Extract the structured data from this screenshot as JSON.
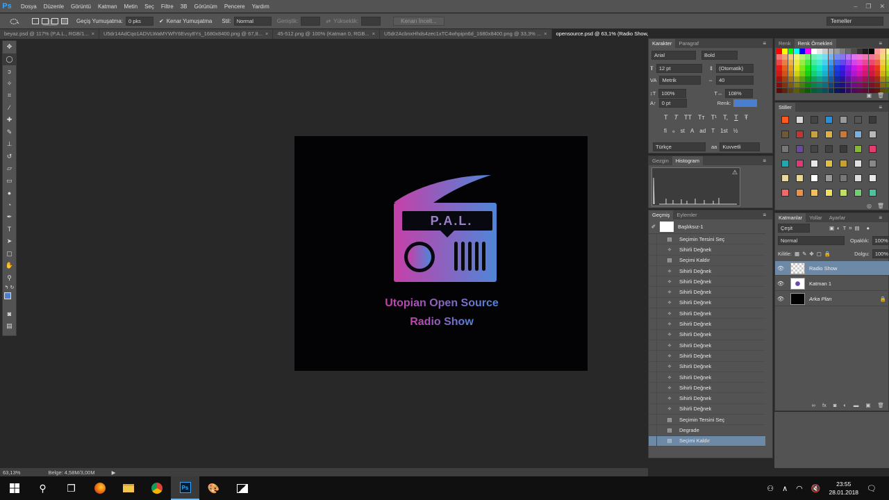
{
  "app_logo": "Ps",
  "menu": [
    "Dosya",
    "Düzenle",
    "Görüntü",
    "Katman",
    "Metin",
    "Seç",
    "Filtre",
    "3B",
    "Görünüm",
    "Pencere",
    "Yardım"
  ],
  "window_controls": [
    "–",
    "❐",
    "✕"
  ],
  "options": {
    "feather_label": "Geçiş Yumuşatma:",
    "feather_value": "0 pks",
    "anti_alias": "Kenar Yumuşatma",
    "style_label": "Stil:",
    "style_value": "Normal",
    "width_label": "Genişlik:",
    "height_label": "Yükseklik:",
    "refine_button": "Kenarı İncelt...",
    "workspace": "Temeller"
  },
  "doc_tabs": [
    {
      "label": "beyaz.psd @ 117% (P.A.L., RGB/1...",
      "close": "×"
    },
    {
      "label": "U5dr14AdCqo1ADVLWaMYWfY6Evsy8Ys_1680x8400.png @ 67,8...",
      "close": "×"
    },
    {
      "label": "45-512.png @ 100% (Katman 0, RGB...",
      "close": "×"
    },
    {
      "label": "U5dr2AcbnxHhds4zec1xTC4whpipn6d_1680x8400.png @ 33,3% ...",
      "close": "×"
    },
    {
      "label": "opensource.psd @ 63,1% (Radio Show, RGB/8)",
      "close": "×"
    }
  ],
  "artwork": {
    "radio_label": "P.A.L.",
    "line1": "Utopian Open Source",
    "line2": "Radio Show",
    "grad_start": "#c540a8",
    "grad_end": "#4f86d8"
  },
  "status": {
    "zoom": "63,13%",
    "doc": "Belge: 4,58M/3,00M",
    "arrow": "▶"
  },
  "character": {
    "tabs": [
      "Karakter",
      "Paragraf"
    ],
    "font": "Arial",
    "style": "Bold",
    "size": "12 pt",
    "leading": "(Otomatik)",
    "kerning": "Metrik",
    "tracking": "40",
    "vscale": "100%",
    "hscale": "108%",
    "baseline": "0 pt",
    "color_label": "Renk:",
    "color": "#4a7fd0",
    "lang": "Türkçe",
    "aa": "Kuvvetli",
    "typo_buttons": [
      "T",
      "T",
      "TT",
      "Tт",
      "T¹",
      "T,",
      "T",
      "Ŧ"
    ],
    "ot_buttons": [
      "fi",
      "ℴ",
      "st",
      "A",
      "ad",
      "T",
      "1st",
      "½"
    ]
  },
  "color_panel": {
    "tabs": [
      "Renk",
      "Renk Örnekleri"
    ]
  },
  "styles_panel": {
    "title": "Stiller"
  },
  "navigator": {
    "tabs": [
      "Gezgin",
      "Histogram"
    ],
    "warn": "⚠"
  },
  "history": {
    "tabs": [
      "Geçmiş",
      "Eylemler"
    ],
    "snapshot": "Başlıksız-1",
    "items": [
      "Seçimin Tersini Seç",
      "Sihirli Değnek",
      "Seçimi Kaldır",
      "Sihirli Değnek",
      "Sihirli Değnek",
      "Sihirli Değnek",
      "Sihirli Değnek",
      "Sihirli Değnek",
      "Sihirli Değnek",
      "Sihirli Değnek",
      "Sihirli Değnek",
      "Sihirli Değnek",
      "Sihirli Değnek",
      "Sihirli Değnek",
      "Sihirli Değnek",
      "Sihirli Değnek",
      "Sihirli Değnek",
      "Seçimin Tersini Seç",
      "Degrade",
      "Seçimi Kaldır"
    ],
    "selected": 19
  },
  "layers": {
    "tabs": [
      "Katmanlar",
      "Yollar",
      "Ayarlar"
    ],
    "filter": "Çeşit",
    "blend": "Normal",
    "opacity_label": "Opaklık:",
    "opacity": "100%",
    "lock_label": "Kilitle:",
    "fill_label": "Dolgu:",
    "fill": "100%",
    "items": [
      {
        "name": "Radio Show",
        "selected": true
      },
      {
        "name": "Katman 1",
        "selected": false
      },
      {
        "name": "Arka Plan",
        "selected": false
      }
    ]
  },
  "taskbar": {
    "time": "23:55",
    "date": "28.01.2018"
  }
}
